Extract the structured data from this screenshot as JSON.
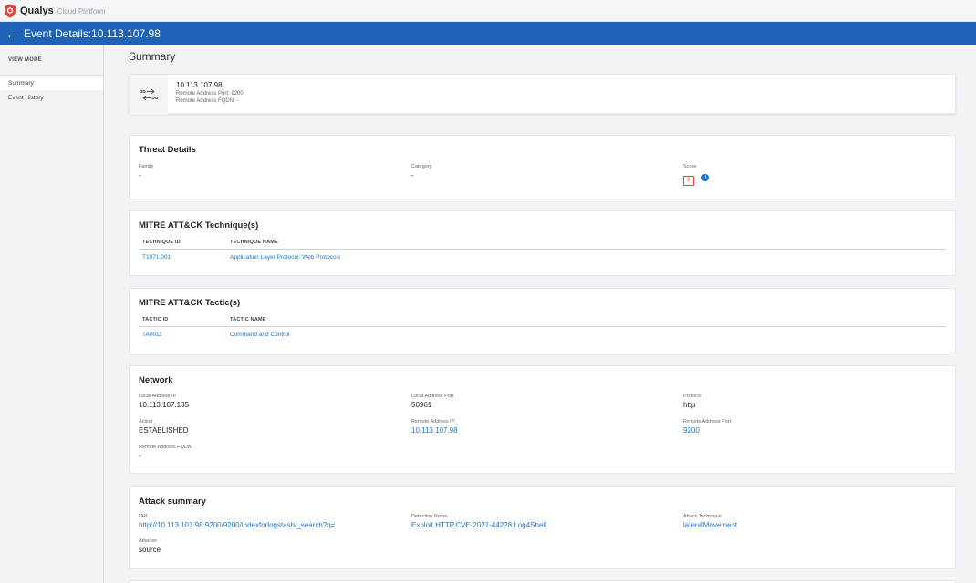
{
  "app": {
    "brand": "Qualys",
    "subtitle": "Cloud Platform"
  },
  "header": {
    "back_icon": "arrow-left",
    "title": "Event Details:10.113.107.98"
  },
  "sidebar": {
    "heading": "VIEW MODE",
    "items": [
      {
        "label": "Summary",
        "active": true
      },
      {
        "label": "Event History",
        "active": false
      }
    ]
  },
  "main": {
    "title": "Summary",
    "address": {
      "icon": "network-transfer-icon",
      "ip": "10.113.107.98",
      "port_line": "Remote Address Port: 9200",
      "fqdn_line": "Remote Address FQDN: -"
    },
    "threat": {
      "title": "Threat Details",
      "family_label": "Family",
      "family_value": "-",
      "category_label": "Category",
      "category_value": "-",
      "score_label": "Score",
      "score_value": "9"
    },
    "techniques": {
      "title": "MITRE ATT&CK Technique(s)",
      "headers": [
        "TECHNIQUE ID",
        "TECHNIQUE NAME"
      ],
      "rows": [
        [
          "T1071.001",
          "Application Layer Protocol: Web Protocols"
        ]
      ]
    },
    "tactics": {
      "title": "MITRE ATT&CK Tactic(s)",
      "headers": [
        "TACTIC ID",
        "TACTIC NAME"
      ],
      "rows": [
        [
          "TA0011",
          "Command and Control"
        ]
      ]
    },
    "network": {
      "title": "Network",
      "local_ip_label": "Local Address IP",
      "local_ip_value": "10.113.107.135",
      "local_port_label": "Local Address Port",
      "local_port_value": "50961",
      "protocol_label": "Protocol",
      "protocol_value": "http",
      "action_label": "Action",
      "action_value": "ESTABLISHED",
      "remote_ip_label": "Remote Address IP",
      "remote_ip_value": "10.113.107.98",
      "remote_port_label": "Remote Address Port",
      "remote_port_value": "9200",
      "remote_fqdn_label": "Remote Address FQDN",
      "remote_fqdn_value": "-"
    },
    "attack": {
      "title": "Attack summary",
      "url_label": "URL",
      "url_value": "http://10.113.107.98:9200/9200/indexforlogstash/_search?q=",
      "detection_label": "Detection Name",
      "detection_value": "Exploit.HTTP.CVE-2021-44228.Log4Shell",
      "technique_label": "Attack Technique",
      "technique_value": "lateralMovement",
      "attacker_label": "Attacker",
      "attacker_value": "source"
    }
  },
  "colors": {
    "brand_red": "#e0453b",
    "header_blue": "#1f63b6",
    "link_blue": "#1f74c9"
  }
}
